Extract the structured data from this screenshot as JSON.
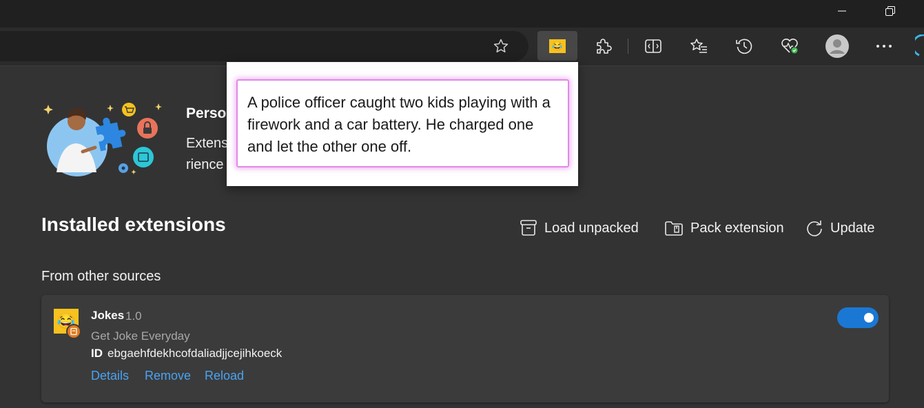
{
  "browser": {
    "toolbar_icons": [
      "star-icon",
      "jokes-extension-icon",
      "extensions-puzzle-icon",
      "split-screen-icon",
      "favorites-icon",
      "history-icon",
      "browser-essentials-icon",
      "profile-avatar",
      "more-menu-icon"
    ]
  },
  "hero": {
    "title": "Perso",
    "body": "Extens                                                                                                                            rience and offer you more c"
  },
  "popup": {
    "joke": "A police officer caught two kids playing with a firework and a car battery. He charged one and let the other one off."
  },
  "installed": {
    "title": "Installed extensions",
    "actions": {
      "load_unpacked": "Load unpacked",
      "pack_extension": "Pack extension",
      "update": "Update"
    }
  },
  "sources": {
    "title": "From other sources"
  },
  "extension": {
    "name": "Jokes",
    "version": "1.0",
    "description": "Get Joke Everyday",
    "id_label": "ID",
    "id": "ebgaehfdekhcofdaliadjjcejihkoeck",
    "enabled": true,
    "links": {
      "details": "Details",
      "remove": "Remove",
      "reload": "Reload"
    }
  },
  "colors": {
    "accent": "#1a78d4",
    "link": "#4aa3f2",
    "popup_border": "#e08ae6",
    "background": "#333333"
  }
}
